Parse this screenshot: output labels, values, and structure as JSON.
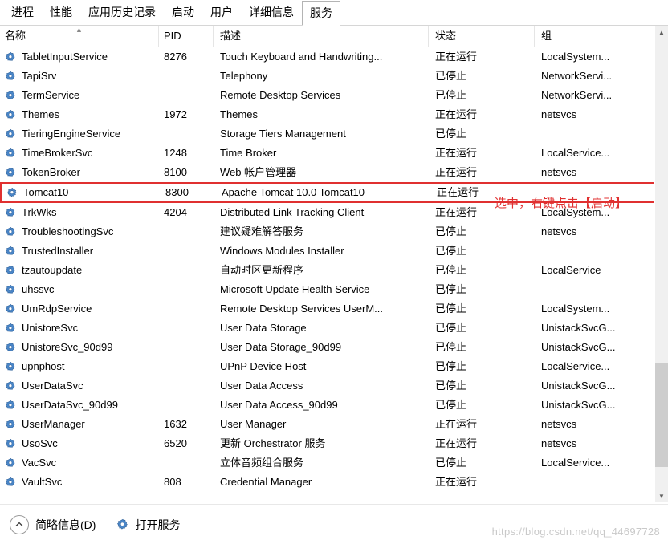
{
  "tabs": [
    {
      "label": "进程",
      "selected": false
    },
    {
      "label": "性能",
      "selected": false
    },
    {
      "label": "应用历史记录",
      "selected": false
    },
    {
      "label": "启动",
      "selected": false
    },
    {
      "label": "用户",
      "selected": false
    },
    {
      "label": "详细信息",
      "selected": false
    },
    {
      "label": "服务",
      "selected": true
    }
  ],
  "columns": {
    "name": "名称",
    "pid": "PID",
    "description": "描述",
    "status": "状态",
    "group": "组"
  },
  "sort_indicator": "▲",
  "annotation": "选中，右键点击【启动】",
  "rows": [
    {
      "name": "TabletInputService",
      "pid": "8276",
      "desc": "Touch Keyboard and Handwriting...",
      "status": "正在运行",
      "group": "LocalSystem...",
      "highlight": false
    },
    {
      "name": "TapiSrv",
      "pid": "",
      "desc": "Telephony",
      "status": "已停止",
      "group": "NetworkServi...",
      "highlight": false
    },
    {
      "name": "TermService",
      "pid": "",
      "desc": "Remote Desktop Services",
      "status": "已停止",
      "group": "NetworkServi...",
      "highlight": false
    },
    {
      "name": "Themes",
      "pid": "1972",
      "desc": "Themes",
      "status": "正在运行",
      "group": "netsvcs",
      "highlight": false
    },
    {
      "name": "TieringEngineService",
      "pid": "",
      "desc": "Storage Tiers Management",
      "status": "已停止",
      "group": "",
      "highlight": false
    },
    {
      "name": "TimeBrokerSvc",
      "pid": "1248",
      "desc": "Time Broker",
      "status": "正在运行",
      "group": "LocalService...",
      "highlight": false
    },
    {
      "name": "TokenBroker",
      "pid": "8100",
      "desc": "Web 帐户管理器",
      "status": "正在运行",
      "group": "netsvcs",
      "highlight": false
    },
    {
      "name": "Tomcat10",
      "pid": "8300",
      "desc": "Apache Tomcat 10.0 Tomcat10",
      "status": "正在运行",
      "group": "",
      "highlight": true
    },
    {
      "name": "TrkWks",
      "pid": "4204",
      "desc": "Distributed Link Tracking Client",
      "status": "正在运行",
      "group": "LocalSystem...",
      "highlight": false
    },
    {
      "name": "TroubleshootingSvc",
      "pid": "",
      "desc": "建议疑难解答服务",
      "status": "已停止",
      "group": "netsvcs",
      "highlight": false
    },
    {
      "name": "TrustedInstaller",
      "pid": "",
      "desc": "Windows Modules Installer",
      "status": "已停止",
      "group": "",
      "highlight": false
    },
    {
      "name": "tzautoupdate",
      "pid": "",
      "desc": "自动时区更新程序",
      "status": "已停止",
      "group": "LocalService",
      "highlight": false
    },
    {
      "name": "uhssvc",
      "pid": "",
      "desc": "Microsoft Update Health Service",
      "status": "已停止",
      "group": "",
      "highlight": false
    },
    {
      "name": "UmRdpService",
      "pid": "",
      "desc": "Remote Desktop Services UserM...",
      "status": "已停止",
      "group": "LocalSystem...",
      "highlight": false
    },
    {
      "name": "UnistoreSvc",
      "pid": "",
      "desc": "User Data Storage",
      "status": "已停止",
      "group": "UnistackSvcG...",
      "highlight": false
    },
    {
      "name": "UnistoreSvc_90d99",
      "pid": "",
      "desc": "User Data Storage_90d99",
      "status": "已停止",
      "group": "UnistackSvcG...",
      "highlight": false
    },
    {
      "name": "upnphost",
      "pid": "",
      "desc": "UPnP Device Host",
      "status": "已停止",
      "group": "LocalService...",
      "highlight": false
    },
    {
      "name": "UserDataSvc",
      "pid": "",
      "desc": "User Data Access",
      "status": "已停止",
      "group": "UnistackSvcG...",
      "highlight": false
    },
    {
      "name": "UserDataSvc_90d99",
      "pid": "",
      "desc": "User Data Access_90d99",
      "status": "已停止",
      "group": "UnistackSvcG...",
      "highlight": false
    },
    {
      "name": "UserManager",
      "pid": "1632",
      "desc": "User Manager",
      "status": "正在运行",
      "group": "netsvcs",
      "highlight": false
    },
    {
      "name": "UsoSvc",
      "pid": "6520",
      "desc": "更新 Orchestrator 服务",
      "status": "正在运行",
      "group": "netsvcs",
      "highlight": false
    },
    {
      "name": "VacSvc",
      "pid": "",
      "desc": "立体音频组合服务",
      "status": "已停止",
      "group": "LocalService...",
      "highlight": false
    },
    {
      "name": "VaultSvc",
      "pid": "808",
      "desc": "Credential Manager",
      "status": "正在运行",
      "group": "",
      "highlight": false
    }
  ],
  "footer": {
    "collapse_label_prefix": "简略信息(",
    "collapse_accel": "D",
    "collapse_label_suffix": ")",
    "open_services_label": "打开服务",
    "chevron_icon": "chevron-up-icon",
    "services_icon": "services-gear-icon"
  },
  "watermark": "https://blog.csdn.net/qq_44697728",
  "colors": {
    "highlight_border": "#e03030",
    "annotation_text": "#e03030",
    "gear_icon": "#4a86c8",
    "scrollbar_thumb": "#cdcdcd",
    "watermark": "#c9c9c9"
  }
}
